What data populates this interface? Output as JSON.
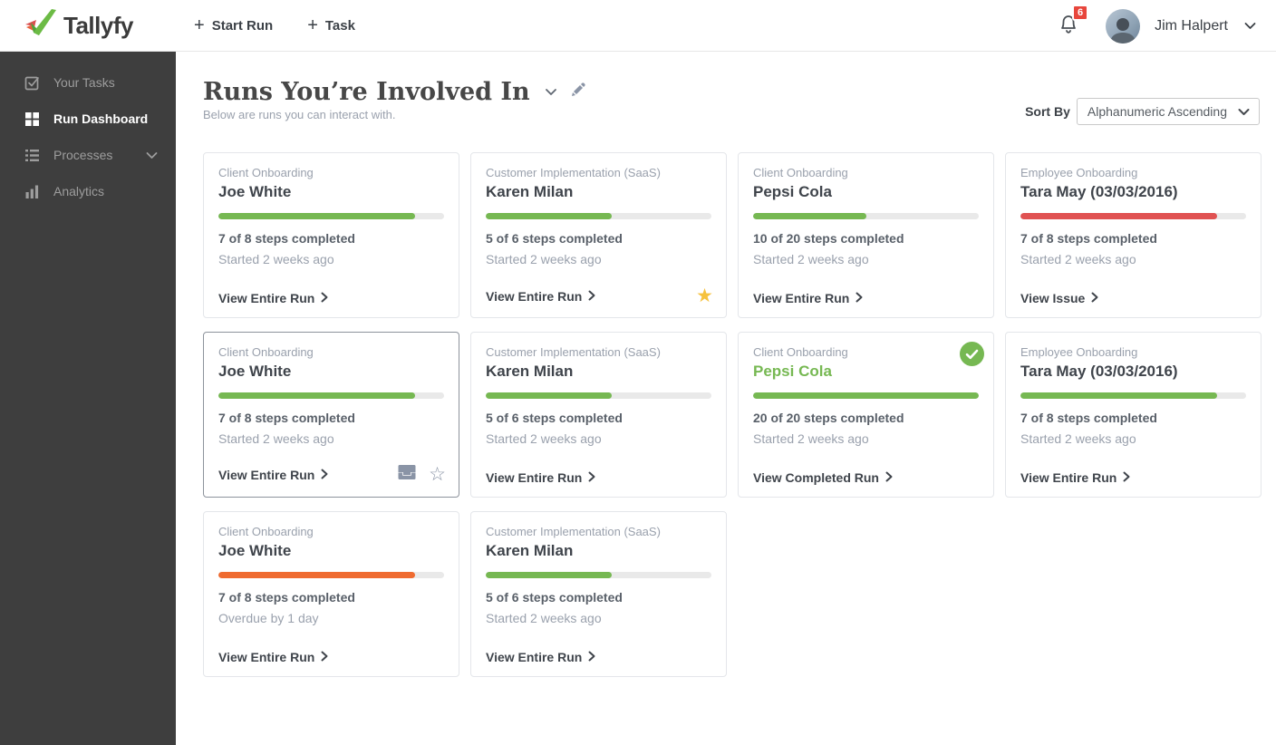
{
  "header": {
    "logo_text": "Tallyfy",
    "start_run_label": "Start Run",
    "task_label": "Task",
    "notification_count": "6",
    "user_name": "Jim Halpert"
  },
  "sidebar": {
    "items": [
      {
        "label": "Your Tasks",
        "icon": "tasks-icon",
        "active": false,
        "has_chevron": false
      },
      {
        "label": "Run Dashboard",
        "icon": "dashboard-icon",
        "active": true,
        "has_chevron": false
      },
      {
        "label": "Processes",
        "icon": "processes-icon",
        "active": false,
        "has_chevron": true
      },
      {
        "label": "Analytics",
        "icon": "analytics-icon",
        "active": false,
        "has_chevron": false
      }
    ]
  },
  "main": {
    "title": "Runs You’re Involved In",
    "subtitle": "Below are runs you can interact with.",
    "sort_by_label": "Sort By",
    "sort_value": "Alphanumeric Ascending",
    "cards": [
      {
        "process": "Client Onboarding",
        "name": "Joe White",
        "name_green": false,
        "progress_percent": 87,
        "progress_color": "#76b852",
        "steps_text": "7 of 8 steps completed",
        "status_text": "Started 2 weeks ago",
        "link_label": "View Entire Run",
        "completed_badge": false,
        "favorite": "none",
        "has_inbox_icon": false,
        "selected": false
      },
      {
        "process": "Customer Implementation (SaaS)",
        "name": "Karen Milan",
        "name_green": false,
        "progress_percent": 56,
        "progress_color": "#76b852",
        "steps_text": "5 of 6 steps completed",
        "status_text": "Started 2 weeks ago",
        "link_label": "View Entire Run",
        "completed_badge": false,
        "favorite": "filled",
        "has_inbox_icon": false,
        "selected": false
      },
      {
        "process": "Client Onboarding",
        "name": "Pepsi Cola",
        "name_green": false,
        "progress_percent": 50,
        "progress_color": "#76b852",
        "steps_text": "10 of 20 steps completed",
        "status_text": "Started 2 weeks ago",
        "link_label": "View Entire Run",
        "completed_badge": false,
        "favorite": "none",
        "has_inbox_icon": false,
        "selected": false
      },
      {
        "process": "Employee Onboarding",
        "name": "Tara May (03/03/2016)",
        "name_green": false,
        "progress_percent": 87,
        "progress_color": "#e05252",
        "steps_text": "7 of 8 steps completed",
        "status_text": "Started 2 weeks ago",
        "link_label": "View Issue",
        "completed_badge": false,
        "favorite": "none",
        "has_inbox_icon": false,
        "selected": false
      },
      {
        "process": "Client Onboarding",
        "name": "Joe White",
        "name_green": false,
        "progress_percent": 87,
        "progress_color": "#76b852",
        "steps_text": "7 of 8 steps completed",
        "status_text": "Started 2 weeks ago",
        "link_label": "View Entire Run",
        "completed_badge": false,
        "favorite": "outline",
        "has_inbox_icon": true,
        "selected": true
      },
      {
        "process": "Customer Implementation (SaaS)",
        "name": "Karen Milan",
        "name_green": false,
        "progress_percent": 56,
        "progress_color": "#76b852",
        "steps_text": "5 of 6 steps completed",
        "status_text": "Started 2 weeks ago",
        "link_label": "View Entire Run",
        "completed_badge": false,
        "favorite": "none",
        "has_inbox_icon": false,
        "selected": false
      },
      {
        "process": "Client Onboarding",
        "name": "Pepsi Cola",
        "name_green": true,
        "progress_percent": 100,
        "progress_color": "#76b852",
        "steps_text": "20 of 20 steps completed",
        "status_text": "Started 2 weeks ago",
        "link_label": "View Completed Run",
        "completed_badge": true,
        "favorite": "none",
        "has_inbox_icon": false,
        "selected": false
      },
      {
        "process": "Employee Onboarding",
        "name": "Tara May (03/03/2016)",
        "name_green": false,
        "progress_percent": 87,
        "progress_color": "#76b852",
        "steps_text": "7 of 8 steps completed",
        "status_text": "Started 2 weeks ago",
        "link_label": "View Entire Run",
        "completed_badge": false,
        "favorite": "none",
        "has_inbox_icon": false,
        "selected": false
      },
      {
        "process": "Client Onboarding",
        "name": "Joe White",
        "name_green": false,
        "progress_percent": 87,
        "progress_color": "#ef6b30",
        "steps_text": "7 of 8 steps completed",
        "status_text": "Overdue by 1 day",
        "link_label": "View Entire Run",
        "completed_badge": false,
        "favorite": "none",
        "has_inbox_icon": false,
        "selected": false
      },
      {
        "process": "Customer Implementation (SaaS)",
        "name": "Karen Milan",
        "name_green": false,
        "progress_percent": 56,
        "progress_color": "#76b852",
        "steps_text": "5 of 6 steps completed",
        "status_text": "Started 2 weeks ago",
        "link_label": "View Entire Run",
        "completed_badge": false,
        "favorite": "none",
        "has_inbox_icon": false,
        "selected": false
      }
    ]
  },
  "colors": {
    "green": "#76b852",
    "red": "#e05252",
    "orange": "#ef6b30",
    "sidebar_bg": "#3e3e3e",
    "badge_red": "#e8463c",
    "star_yellow": "#f6c23d",
    "muted_text": "#9aa1ad",
    "dark_text": "#3f444b"
  }
}
